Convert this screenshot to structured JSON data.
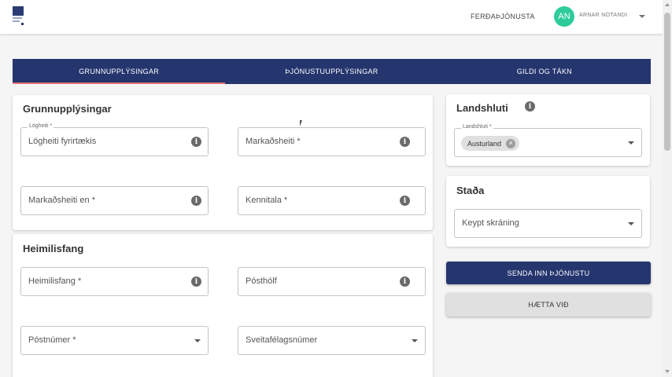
{
  "header": {
    "nav_link": "FERÐAÞJÓNUSTA",
    "avatar_initials": "AN",
    "user_name": "ARNAR NOTANDI"
  },
  "tabs": [
    {
      "label": "GRUNNUPPLÝSINGAR",
      "active": true
    },
    {
      "label": "ÞJÓNUSTUUPPLÝSINGAR",
      "active": false
    },
    {
      "label": "GILDI OG TÁKN",
      "active": false
    }
  ],
  "basic_info": {
    "title": "Grunnupplýsingar",
    "legal_name": {
      "label": "Lögheiti *",
      "value": "Lögheiti fyrirtækis"
    },
    "marketing_name": {
      "placeholder": "Markaðsheiti *"
    },
    "marketing_name_en": {
      "placeholder": "Markaðsheiti en *"
    },
    "kennitala": {
      "placeholder": "Kennitala *"
    }
  },
  "address": {
    "title": "Heimilisfang",
    "street": {
      "placeholder": "Heimilisfang *"
    },
    "po_box": {
      "placeholder": "Pósthólf"
    },
    "postal_code": {
      "placeholder": "Póstnúmer *"
    },
    "municipality": {
      "placeholder": "Sveitafélagsnúmer"
    }
  },
  "region": {
    "title": "Landshluti",
    "field_label": "Landshluti *",
    "chip": "Austurland"
  },
  "status": {
    "title": "Staða",
    "value": "Keypt skráning"
  },
  "actions": {
    "submit": "SENDA INN ÞJÓNUSTU",
    "cancel": "HÆTTA VIÐ"
  },
  "colors": {
    "primary": "#25356e",
    "accent": "#e57373",
    "avatar": "#2ecc9a"
  },
  "icons": [
    "logo",
    "info-icon",
    "chevron-down-icon",
    "clear-chip-icon"
  ]
}
